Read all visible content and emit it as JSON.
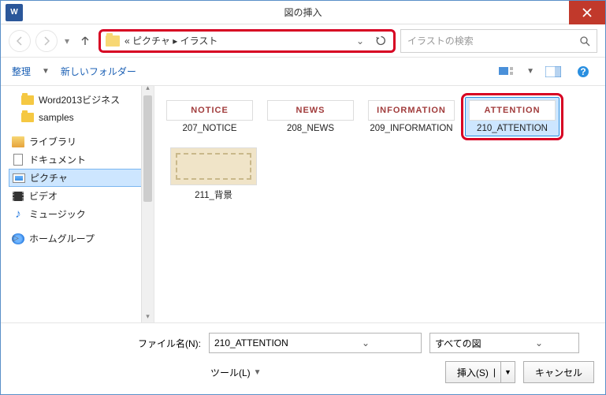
{
  "title": "図の挿入",
  "path": {
    "crumbs_text": "«  ピクチャ  ▸  イラスト"
  },
  "search_placeholder": "イラストの検索",
  "toolbar": {
    "organize": "整理",
    "newfolder": "新しいフォルダー"
  },
  "tree": {
    "items_a": [
      {
        "label": "Word2013ビジネス"
      },
      {
        "label": "samples"
      }
    ],
    "lib_label": "ライブラリ",
    "lib_items": [
      {
        "label": "ドキュメント",
        "icon": "doc"
      },
      {
        "label": "ピクチャ",
        "icon": "pic",
        "selected": true
      },
      {
        "label": "ビデオ",
        "icon": "vid"
      },
      {
        "label": "ミュージック",
        "icon": "mus"
      }
    ],
    "homegroup": "ホームグループ"
  },
  "files": [
    {
      "thumb_text": "NOTICE",
      "name": "207_NOTICE"
    },
    {
      "thumb_text": "NEWS",
      "name": "208_NEWS"
    },
    {
      "thumb_text": "INFORMATION",
      "name": "209_INFORMATION"
    },
    {
      "thumb_text": "ATTENTION",
      "name": "210_ATTENTION",
      "selected": true
    },
    {
      "thumb_text": "",
      "name": "211_背景",
      "bg": true
    }
  ],
  "footer": {
    "filename_label": "ファイル名(N):",
    "filename_value": "210_ATTENTION",
    "filter_value": "すべての図",
    "tools_label": "ツール(L)",
    "insert_label": "挿入(S)",
    "cancel_label": "キャンセル"
  }
}
